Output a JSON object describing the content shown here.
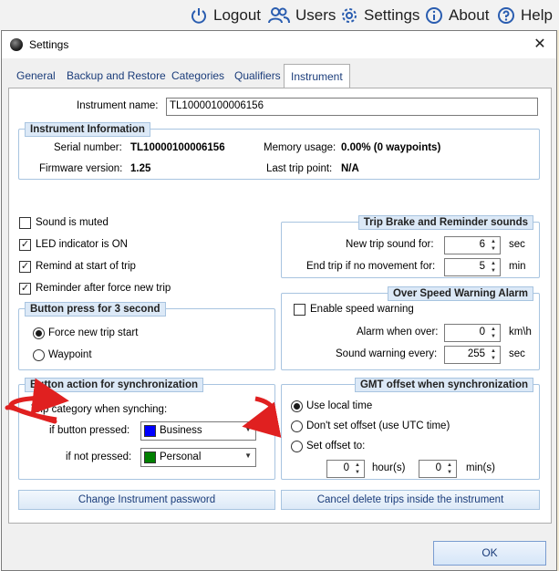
{
  "topnav": {
    "logout": "Logout",
    "users": "Users",
    "settings": "Settings",
    "about": "About",
    "help": "Help"
  },
  "dialog": {
    "title": "Settings",
    "close": "✕",
    "tabs": [
      "General",
      "Backup and Restore",
      "Categories",
      "Qualifiers",
      "Instrument"
    ],
    "active_tab": "Instrument",
    "ok_label": "OK"
  },
  "instrument": {
    "name_label": "Instrument name:",
    "name_value": "TL10000100006156",
    "info_title": "Instrument Information",
    "serial_label": "Serial number:",
    "serial_value": "TL10000100006156",
    "firmware_label": "Firmware version:",
    "firmware_value": "1.25",
    "memory_label": "Memory usage:",
    "memory_value": "0.00% (0 waypoints)",
    "lasttrip_label": "Last trip point:",
    "lasttrip_value": "N/A"
  },
  "checks": {
    "sound_muted": {
      "label": "Sound is muted",
      "checked": false
    },
    "led_on": {
      "label": "LED indicator is ON",
      "checked": true
    },
    "remind_start": {
      "label": "Remind at start of trip",
      "checked": true
    },
    "reminder_force": {
      "label": "Reminder after force new trip",
      "checked": true
    }
  },
  "button_press": {
    "title": "Button press for 3 second",
    "opt_force": "Force new trip start",
    "opt_waypoint": "Waypoint",
    "selected": "Force new trip start"
  },
  "trip_brake": {
    "title": "Trip Brake and Reminder sounds",
    "new_trip_label": "New trip sound for:",
    "new_trip_value": "6",
    "new_trip_unit": "sec",
    "end_trip_label": "End trip if no movement for:",
    "end_trip_value": "5",
    "end_trip_unit": "min"
  },
  "overspeed": {
    "title": "Over Speed Warning Alarm",
    "enable_label": "Enable speed warning",
    "enabled": false,
    "alarm_label": "Alarm when over:",
    "alarm_value": "0",
    "alarm_unit": "km\\h",
    "warn_label": "Sound warning every:",
    "warn_value": "255",
    "warn_unit": "sec"
  },
  "sync_action": {
    "title": "Button action for synchronization",
    "category_label": "Trip category when synching:",
    "pressed_label": "if button pressed:",
    "pressed_value": "Business",
    "pressed_color": "#0000ff",
    "not_pressed_label": "if not pressed:",
    "not_pressed_value": "Personal",
    "not_pressed_color": "#008000"
  },
  "gmt": {
    "title": "GMT offset when synchronization",
    "opt_local": "Use local time",
    "opt_utc": "Don't set offset (use UTC time)",
    "opt_set": "Set offset to:",
    "selected": "Use local time",
    "hours_value": "0",
    "hours_unit": "hour(s)",
    "mins_value": "0",
    "mins_unit": "min(s)"
  },
  "buttons": {
    "change_password": "Change Instrument password",
    "cancel_delete": "Cancel delete trips inside the instrument"
  },
  "colors": {
    "accent": "#1a3c7a",
    "group_border": "#a8c4e0",
    "annotation_arrow": "#e02020"
  }
}
